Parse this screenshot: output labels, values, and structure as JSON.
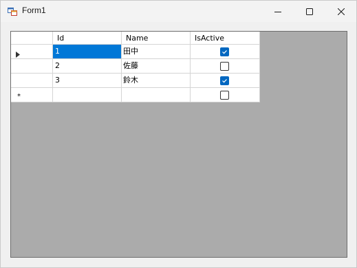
{
  "window": {
    "title": "Form1",
    "icon": "winforms-app-icon",
    "controls": [
      "minimize-icon",
      "maximize-icon",
      "close-icon"
    ]
  },
  "grid": {
    "columns": [
      {
        "header": "Id"
      },
      {
        "header": "Name"
      },
      {
        "header": "IsActive"
      }
    ],
    "rows": [
      {
        "id": "1",
        "name": "田中",
        "is_active": true,
        "current": true
      },
      {
        "id": "2",
        "name": "佐藤",
        "is_active": false,
        "current": false
      },
      {
        "id": "3",
        "name": "鈴木",
        "is_active": true,
        "current": false
      }
    ],
    "new_row_marker": "*",
    "current_row_marker": "row-pointer-arrow-icon",
    "colors": {
      "selection": "#0078d7",
      "checkbox_checked": "#0067c0",
      "background": "#ababab"
    }
  }
}
